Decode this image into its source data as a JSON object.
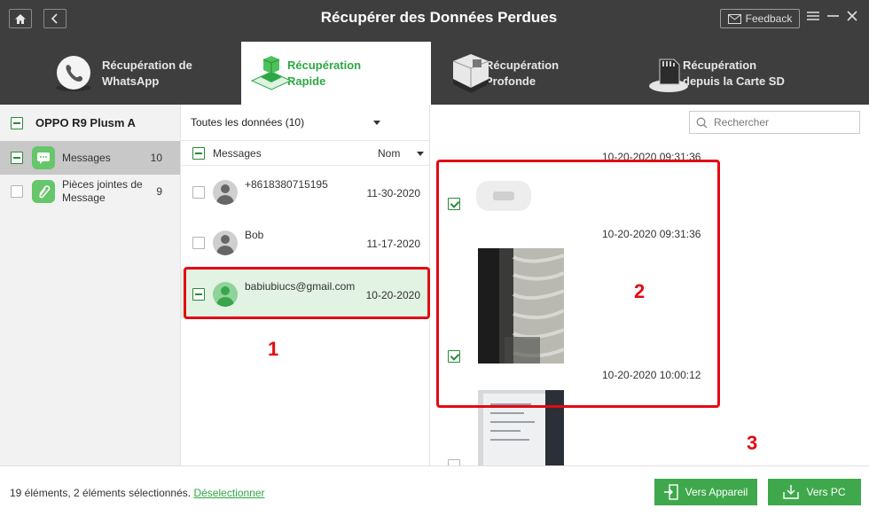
{
  "window": {
    "title": "Récupérer des Données Perdues",
    "feedback_label": "Feedback"
  },
  "tabs": [
    {
      "line1": "Récupération de",
      "line2": "WhatsApp"
    },
    {
      "line1": "Récupération",
      "line2": "Rapide"
    },
    {
      "line1": "Récupération",
      "line2": "Profonde"
    },
    {
      "line1": "Récupération",
      "line2": "depuis la Carte SD"
    }
  ],
  "sidebar": {
    "device": "OPPO R9 Plusm A",
    "items": [
      {
        "label": "Messages",
        "count": "10"
      },
      {
        "label1": "Pièces jointes de",
        "label2": "Message",
        "count": "9"
      }
    ]
  },
  "list": {
    "filter": "Toutes les données (10)",
    "header_label": "Messages",
    "sort_label": "Nom",
    "rows": [
      {
        "name": "+8618380715195",
        "date": "11-30-2020"
      },
      {
        "name": "Bob",
        "date": "11-17-2020"
      },
      {
        "name": "babiubiucs@gmail.com",
        "date": "10-20-2020"
      }
    ]
  },
  "search": {
    "placeholder": "Rechercher"
  },
  "detail": {
    "timestamps": [
      "10-20-2020 09:31:36",
      "10-20-2020 09:31:36",
      "10-20-2020 10:00:12"
    ]
  },
  "annotations": {
    "n1": "1",
    "n2": "2",
    "n3": "3"
  },
  "footer": {
    "status": "19 éléments, 2 éléments sélectionnés.",
    "deselect": "Déselectionner",
    "to_device": "Vers Appareil",
    "to_pc": "Vers PC"
  },
  "colors": {
    "accent": "#2ea744",
    "topbar": "#3e3e3e",
    "annotation": "#e30a14",
    "button": "#3fa84c"
  }
}
